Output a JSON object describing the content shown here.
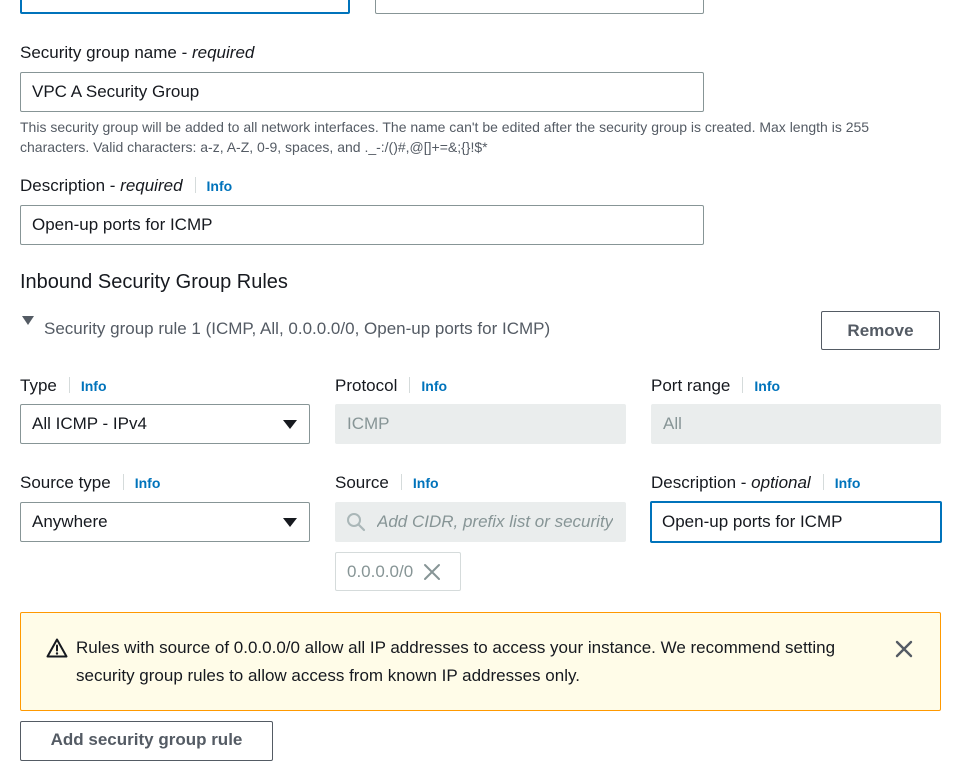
{
  "top_partial": {
    "left_field_value": "",
    "right_field_value": ""
  },
  "sg_name": {
    "label": "Security group name",
    "required": "required",
    "value": "VPC A Security Group",
    "hint": "This security group will be added to all network interfaces. The name can't be edited after the security group is created. Max length is 255 characters. Valid characters: a-z, A-Z, 0-9, spaces, and ._-:/()#,@[]+=&;{}!$*"
  },
  "description": {
    "label": "Description",
    "required": "required",
    "info": "Info",
    "value": "Open-up ports for ICMP"
  },
  "inbound": {
    "heading": "Inbound Security Group Rules",
    "rule_title": "Security group rule 1 (ICMP, All, 0.0.0.0/0, Open-up ports for ICMP)",
    "remove_label": "Remove",
    "type": {
      "label": "Type",
      "info": "Info",
      "value": "All ICMP - IPv4"
    },
    "protocol": {
      "label": "Protocol",
      "info": "Info",
      "value": "ICMP"
    },
    "port_range": {
      "label": "Port range",
      "info": "Info",
      "value": "All"
    },
    "source_type": {
      "label": "Source type",
      "info": "Info",
      "value": "Anywhere"
    },
    "source": {
      "label": "Source",
      "info": "Info",
      "placeholder": "Add CIDR, prefix list or security",
      "token": "0.0.0.0/0"
    },
    "rule_description": {
      "label": "Description",
      "optional": "optional",
      "info": "Info",
      "value": "Open-up ports for ICMP"
    }
  },
  "warning": {
    "text": "Rules with source of 0.0.0.0/0 allow all IP addresses to access your instance. We recommend setting security group rules to allow access from known IP addresses only."
  },
  "add_rule_label": "Add security group rule",
  "colors": {
    "link": "#0073bb",
    "warning_border": "#ff9900",
    "warning_bg": "#fffce8",
    "focus": "#0073bb"
  }
}
